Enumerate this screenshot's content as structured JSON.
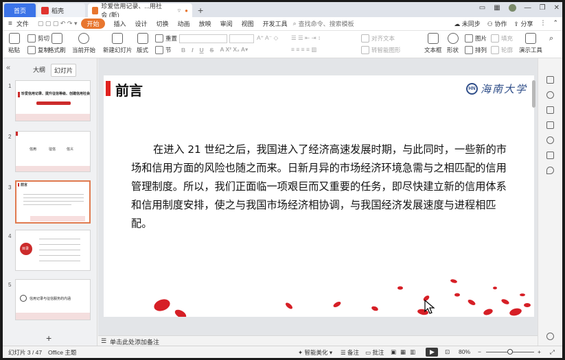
{
  "tabs": {
    "home": "首页",
    "daoke": "稻壳",
    "document": "珍爱信用记录、...用社会 (新)"
  },
  "menu": {
    "file": "文件",
    "start": "开始",
    "insert": "插入",
    "design": "设计",
    "switch": "切换",
    "animation": "动画",
    "slideshow": "放映",
    "review": "审阅",
    "view": "视图",
    "developer": "开发工具",
    "search_placeholder": "查找命令、搜索模板",
    "not_synced": "未同步",
    "collaborate": "协作",
    "share": "分享"
  },
  "ribbon": {
    "paste": "粘贴",
    "cut": "剪切",
    "copy": "复制",
    "format_painter": "格式刷",
    "play_from_current": "当前开始",
    "new_slide": "新建幻灯片",
    "layout": "版式",
    "section": "节",
    "reset": "重置",
    "align_text": "对齐文本",
    "convert_smartart": "转智能图形",
    "textbox": "文本框",
    "shape": "形状",
    "picture": "图片",
    "arrange": "排列",
    "fill": "填充",
    "outline": "轮廓",
    "presentation_tools": "演示工具",
    "font_buttons": [
      "B",
      "I",
      "U",
      "S"
    ]
  },
  "panel": {
    "outline_tab": "大纲",
    "slides_tab": "幻灯片",
    "slide_numbers": [
      "1",
      "2",
      "3",
      "4",
      "5"
    ]
  },
  "thumbnails": {
    "slide1_title": "珍爱信用记录、提升征信等级、创建信用社会",
    "slide2_items": [
      "信用",
      "征信",
      "信义"
    ],
    "slide3_title": "前言",
    "slide4_label": "目录",
    "slide5_title": "信用记录与征信服务的内涵"
  },
  "slide": {
    "title": "前言",
    "logo_mark": "HN",
    "logo_text": "海南大学",
    "body": "在进入 21 世纪之后，我国进入了经济高速发展时期，与此同时，一些新的市场和信用方面的风险也随之而来。日新月异的市场经济环境急需与之相匹配的信用管理制度。所以，我们正面临一项艰巨而又重要的任务，即尽快建立新的信用体系和信用制度安排，使之与我国市场经济相协调，与我国经济发展速度与进程相匹配。"
  },
  "notes": {
    "placeholder": "单击此处添加备注"
  },
  "status": {
    "slide_counter": "幻灯片 3 / 47",
    "theme": "Office 主题",
    "smart_beautify": "智能美化",
    "notes": "备注",
    "comments": "批注",
    "zoom": "80%"
  },
  "colors": {
    "accent": "#e8762f",
    "title_bar": "#e0221f",
    "home_tab": "#3b73e8",
    "logo": "#2f4e89"
  }
}
